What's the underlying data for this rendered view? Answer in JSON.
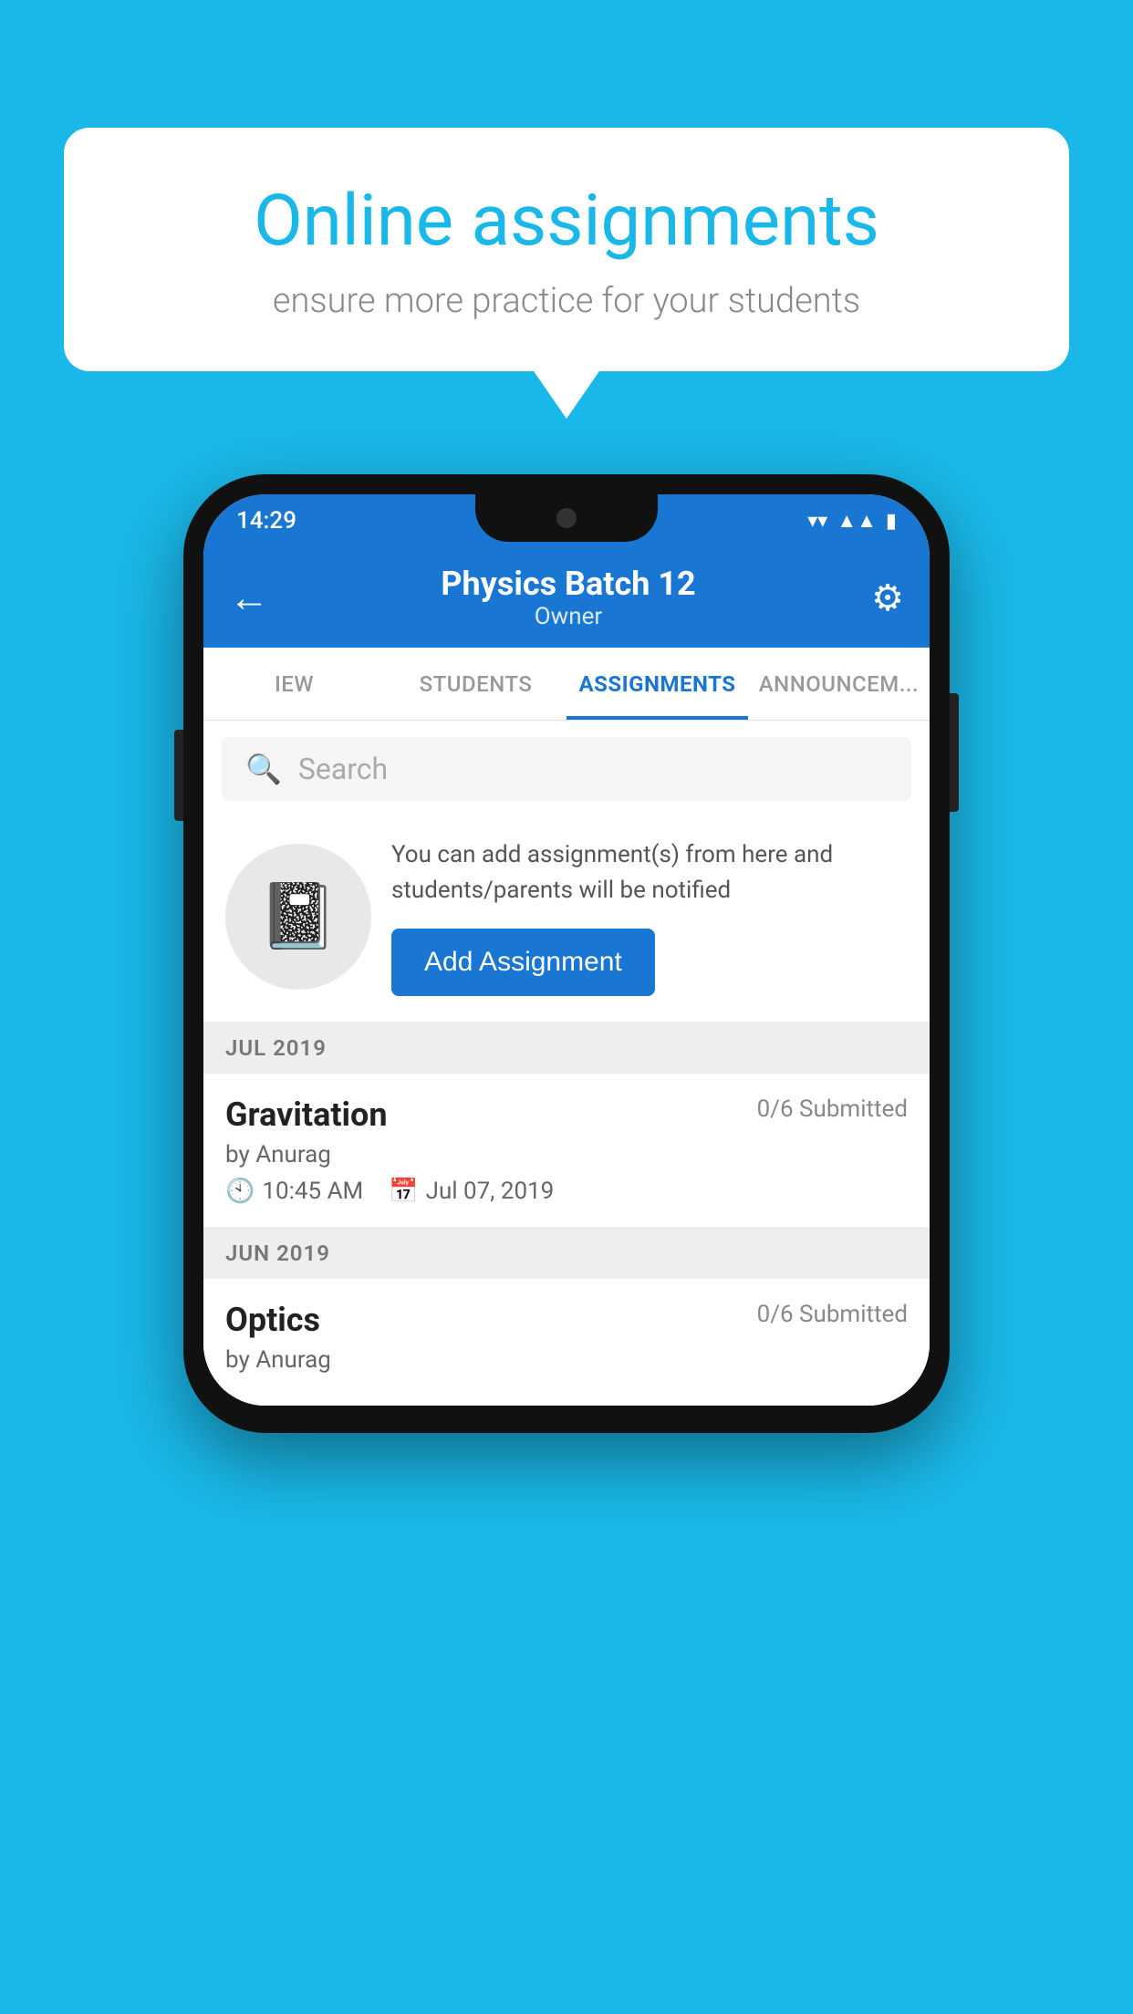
{
  "background_color": "#1ab8e8",
  "speech_bubble": {
    "title": "Online assignments",
    "subtitle": "ensure more practice for your students"
  },
  "status_bar": {
    "time": "14:29",
    "icons": [
      "wifi",
      "signal",
      "battery"
    ]
  },
  "app_bar": {
    "title": "Physics Batch 12",
    "subtitle": "Owner",
    "back_label": "←",
    "settings_label": "⚙"
  },
  "tabs": [
    {
      "label": "IEW",
      "active": false
    },
    {
      "label": "STUDENTS",
      "active": false
    },
    {
      "label": "ASSIGNMENTS",
      "active": true
    },
    {
      "label": "ANNOUNCEM...",
      "active": false
    }
  ],
  "search": {
    "placeholder": "Search"
  },
  "info_card": {
    "description": "You can add assignment(s) from here and students/parents will be notified",
    "button_label": "Add Assignment"
  },
  "sections": [
    {
      "label": "JUL 2019",
      "assignments": [
        {
          "name": "Gravitation",
          "submitted": "0/6 Submitted",
          "by": "by Anurag",
          "time": "10:45 AM",
          "date": "Jul 07, 2019"
        }
      ]
    },
    {
      "label": "JUN 2019",
      "assignments": [
        {
          "name": "Optics",
          "submitted": "0/6 Submitted",
          "by": "by Anurag",
          "time": "",
          "date": ""
        }
      ]
    }
  ]
}
